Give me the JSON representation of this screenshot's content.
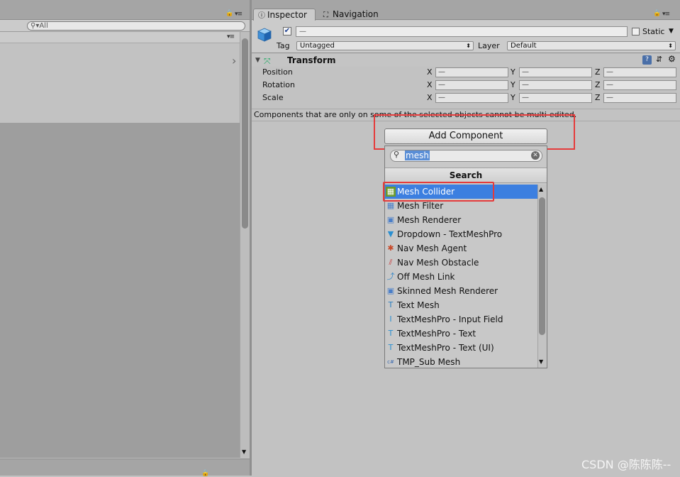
{
  "hierarchy": {
    "search_placeholder": "All",
    "lock_glyph": "🔒",
    "menu_glyph": "▾≡",
    "expand_glyph": "›"
  },
  "inspector": {
    "tabs": [
      {
        "label": "Inspector",
        "icon": "info-icon"
      },
      {
        "label": "Navigation",
        "icon": "navigation-icon"
      }
    ],
    "object": {
      "active": true,
      "name": "—",
      "static_label": "Static",
      "tag_label": "Tag",
      "tag_value": "Untagged",
      "layer_label": "Layer",
      "layer_value": "Default"
    },
    "transform": {
      "title": "Transform",
      "rows": [
        {
          "label": "Position",
          "x": "—",
          "y": "—",
          "z": "—"
        },
        {
          "label": "Rotation",
          "x": "—",
          "y": "—",
          "z": "—"
        },
        {
          "label": "Scale",
          "x": "—",
          "y": "—",
          "z": "—"
        }
      ],
      "axis_labels": [
        "X",
        "Y",
        "Z"
      ]
    },
    "multi_edit_note": "Components that are only on some of the selected objects cannot be multi-edited.",
    "add_component_label": "Add Component"
  },
  "component_search": {
    "query": "mesh",
    "header": "Search",
    "results": [
      {
        "label": "Mesh Collider",
        "icon": "mesh-collider-icon",
        "glyph": "▦",
        "color": "#6a9a2a",
        "selected": true
      },
      {
        "label": "Mesh Filter",
        "icon": "mesh-filter-icon",
        "glyph": "▦",
        "color": "#4a7ec8",
        "selected": false
      },
      {
        "label": "Mesh Renderer",
        "icon": "mesh-renderer-icon",
        "glyph": "▣",
        "color": "#4a7ec8",
        "selected": false
      },
      {
        "label": "Dropdown - TextMeshPro",
        "icon": "dropdown-icon",
        "glyph": "▼",
        "color": "#2a8fd0",
        "selected": false
      },
      {
        "label": "Nav Mesh Agent",
        "icon": "nav-mesh-agent-icon",
        "glyph": "✱",
        "color": "#c84a2a",
        "selected": false
      },
      {
        "label": "Nav Mesh Obstacle",
        "icon": "nav-mesh-obstacle-icon",
        "glyph": "⫽",
        "color": "#c83a3a",
        "selected": false
      },
      {
        "label": "Off Mesh Link",
        "icon": "off-mesh-link-icon",
        "glyph": "⤴",
        "color": "#3a8ac8",
        "selected": false
      },
      {
        "label": "Skinned Mesh Renderer",
        "icon": "skinned-mesh-renderer-icon",
        "glyph": "▣",
        "color": "#4a7ec8",
        "selected": false
      },
      {
        "label": "Text Mesh",
        "icon": "text-mesh-icon",
        "glyph": "T",
        "color": "#2a7ec0",
        "selected": false
      },
      {
        "label": "TextMeshPro - Input Field",
        "icon": "tmp-input-field-icon",
        "glyph": "I",
        "color": "#2a8fd0",
        "selected": false
      },
      {
        "label": "TextMeshPro - Text",
        "icon": "tmp-text-icon",
        "glyph": "T",
        "color": "#2a8fd0",
        "selected": false
      },
      {
        "label": "TextMeshPro - Text (UI)",
        "icon": "tmp-text-ui-icon",
        "glyph": "T",
        "color": "#2a8fd0",
        "selected": false
      },
      {
        "label": "TMP_Sub Mesh",
        "icon": "csharp-script-icon",
        "glyph": "c#",
        "color": "#3a6ab0",
        "selected": false
      }
    ]
  },
  "watermark": "CSDN @陈陈陈--",
  "colors": {
    "highlight_box": "#e53b3b",
    "selection": "#3c7fe0"
  }
}
